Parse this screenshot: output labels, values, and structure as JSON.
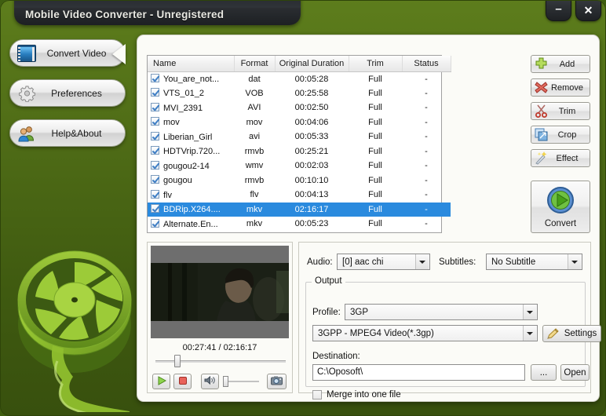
{
  "window": {
    "title": "Mobile Video Converter - Unregistered",
    "minimize_glyph": "–",
    "close_glyph": "✕",
    "accent_green": "#4e6b16",
    "selection_blue": "#2a8ade"
  },
  "sidebar": {
    "items": [
      {
        "label": "Convert Video",
        "icon": "film-strip-icon"
      },
      {
        "label": "Preferences",
        "icon": "gear-icon"
      },
      {
        "label": "Help&About",
        "icon": "people-icon"
      }
    ]
  },
  "file_list": {
    "columns": [
      "Name",
      "Format",
      "Original Duration",
      "Trim",
      "Status"
    ],
    "rows": [
      {
        "checked": true,
        "name": "You_are_not...",
        "format": "dat",
        "duration": "00:05:28",
        "trim": "Full",
        "status": "-",
        "selected": false
      },
      {
        "checked": true,
        "name": "VTS_01_2",
        "format": "VOB",
        "duration": "00:25:58",
        "trim": "Full",
        "status": "-",
        "selected": false
      },
      {
        "checked": true,
        "name": "MVI_2391",
        "format": "AVI",
        "duration": "00:02:50",
        "trim": "Full",
        "status": "-",
        "selected": false
      },
      {
        "checked": true,
        "name": "mov",
        "format": "mov",
        "duration": "00:04:06",
        "trim": "Full",
        "status": "-",
        "selected": false
      },
      {
        "checked": true,
        "name": "Liberian_Girl",
        "format": "avi",
        "duration": "00:05:33",
        "trim": "Full",
        "status": "-",
        "selected": false
      },
      {
        "checked": true,
        "name": "HDTVrip.720...",
        "format": "rmvb",
        "duration": "00:25:21",
        "trim": "Full",
        "status": "-",
        "selected": false
      },
      {
        "checked": true,
        "name": "gougou2-14",
        "format": "wmv",
        "duration": "00:02:03",
        "trim": "Full",
        "status": "-",
        "selected": false
      },
      {
        "checked": true,
        "name": "gougou",
        "format": "rmvb",
        "duration": "00:10:10",
        "trim": "Full",
        "status": "-",
        "selected": false
      },
      {
        "checked": true,
        "name": "flv",
        "format": "flv",
        "duration": "00:04:13",
        "trim": "Full",
        "status": "-",
        "selected": false
      },
      {
        "checked": true,
        "name": "BDRip.X264....",
        "format": "mkv",
        "duration": "02:16:17",
        "trim": "Full",
        "status": "-",
        "selected": true
      },
      {
        "checked": true,
        "name": "Alternate.En...",
        "format": "mkv",
        "duration": "00:05:23",
        "trim": "Full",
        "status": "-",
        "selected": false
      }
    ]
  },
  "actions": {
    "add": {
      "label": "Add",
      "icon": "plus-icon"
    },
    "remove": {
      "label": "Remove",
      "icon": "red-x-icon"
    },
    "trim": {
      "label": "Trim",
      "icon": "scissors-icon"
    },
    "crop": {
      "label": "Crop",
      "icon": "crop-icon"
    },
    "effect": {
      "label": "Effect",
      "icon": "magic-wand-icon"
    },
    "convert": {
      "label": "Convert",
      "icon": "play-circle-icon"
    }
  },
  "preview": {
    "time": "00:27:41 / 02:16:17",
    "play_icon": "play-icon",
    "stop_icon": "stop-icon",
    "volume_icon": "speaker-icon",
    "snapshot_icon": "camera-icon"
  },
  "settings": {
    "audio_label": "Audio:",
    "audio_value": "[0] aac chi",
    "subtitles_label": "Subtitles:",
    "subtitles_value": "No Subtitle",
    "output_legend": "Output",
    "profile_label": "Profile:",
    "profile_value": "3GP",
    "format_value": "3GPP - MPEG4 Video(*.3gp)",
    "settings_button": "Settings",
    "settings_icon": "pencil-icon",
    "destination_label": "Destination:",
    "destination_value": "C:\\Oposoft\\",
    "browse_button": "...",
    "open_button": "Open",
    "merge_label": "Merge into one file",
    "merge_checked": false
  }
}
